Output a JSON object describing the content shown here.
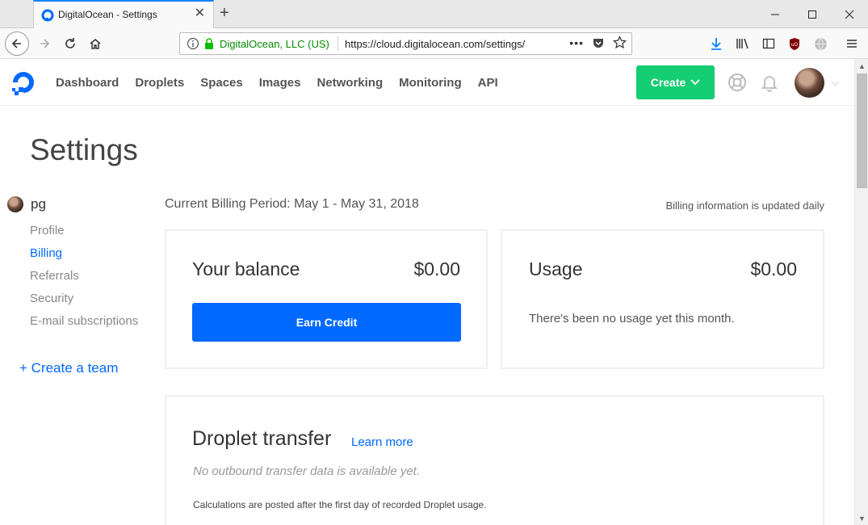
{
  "browser": {
    "tab_title": "DigitalOcean - Settings",
    "url_org": "DigitalOcean, LLC (US)",
    "url": "https://cloud.digitalocean.com/settings/",
    "icons": [
      "back-icon",
      "forward-icon",
      "reload-icon",
      "home-icon",
      "info-icon",
      "lock-icon",
      "more-icon",
      "pocket-icon",
      "bookmark-star-icon",
      "download-icon",
      "library-icon",
      "sidebar-icon",
      "ublock-icon",
      "globe-icon",
      "menu-icon"
    ]
  },
  "header": {
    "nav": [
      "Dashboard",
      "Droplets",
      "Spaces",
      "Images",
      "Networking",
      "Monitoring",
      "API"
    ],
    "create_label": "Create",
    "brand_color": "#0069ff",
    "create_color": "#15cd72"
  },
  "page": {
    "title": "Settings"
  },
  "sidebar": {
    "username": "pg",
    "items": [
      {
        "label": "Profile",
        "active": false
      },
      {
        "label": "Billing",
        "active": true
      },
      {
        "label": "Referrals",
        "active": false
      },
      {
        "label": "Security",
        "active": false
      },
      {
        "label": "E-mail subscriptions",
        "active": false
      }
    ],
    "create_team": "+ Create a team"
  },
  "billing": {
    "period": "Current Billing Period: May 1 - May 31, 2018",
    "info": "Billing information is updated daily",
    "balance_label": "Your balance",
    "balance_amount": "$0.00",
    "earn_credit": "Earn Credit",
    "usage_label": "Usage",
    "usage_amount": "$0.00",
    "usage_message": "There's been no usage yet this month.",
    "transfer_title": "Droplet transfer",
    "learn_more": "Learn more",
    "transfer_empty": "No outbound transfer data is available yet.",
    "transfer_note": "Calculations are posted after the first day of recorded Droplet usage."
  }
}
